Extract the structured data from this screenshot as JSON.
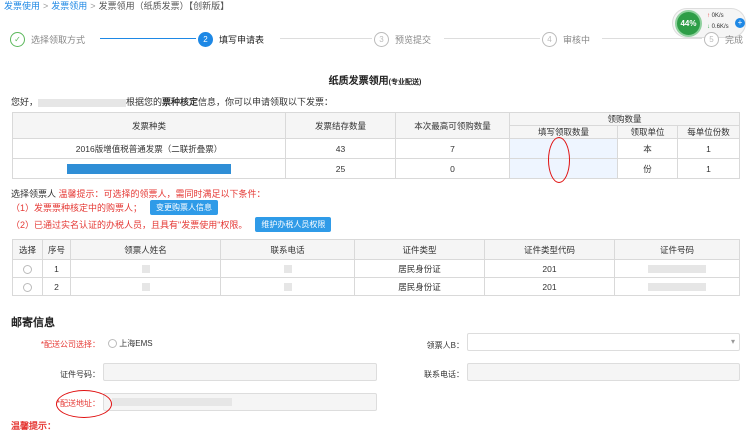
{
  "breadcrumb": {
    "item1": "发票使用",
    "item2": "发票领用",
    "current": "发票领用（纸质发票）【创新版】",
    "separator": ">"
  },
  "steps": [
    {
      "num": "✓",
      "label": "选择领取方式",
      "state": "done"
    },
    {
      "num": "2",
      "label": "填写申请表",
      "state": "active"
    },
    {
      "num": "3",
      "label": "预览提交",
      "state": "todo"
    },
    {
      "num": "4",
      "label": "审核中",
      "state": "todo"
    },
    {
      "num": "5",
      "label": "完成",
      "state": "todo"
    }
  ],
  "net_widget": {
    "percent": "44%",
    "up_speed": "0K/s",
    "down_speed": "0.6K/s",
    "up_arrow": "↑",
    "down_arrow": "↓",
    "plus": "+"
  },
  "page_title": {
    "main": "纸质发票领用",
    "sub": "(专业配送)"
  },
  "greeting": {
    "prefix": "您好，",
    "mid": "根据您的",
    "bold": "票种核定",
    "suffix": "信息，你可以申请领取以下发票："
  },
  "invoice_table": {
    "headers": {
      "type": "发票种类",
      "stock": "发票结存数量",
      "max": "本次最高可领购数量",
      "group": "领购数量",
      "fill": "填写领取数量",
      "unit": "领取单位",
      "per_unit": "每单位份数"
    },
    "rows": [
      {
        "type": "2016版增值税普通发票（二联折叠票）",
        "stock": "43",
        "max": "7",
        "fill": "",
        "unit": "本",
        "per_unit": "1"
      },
      {
        "type": "",
        "stock": "25",
        "max": "0",
        "fill": "",
        "unit": "份",
        "per_unit": "1"
      }
    ]
  },
  "recipient_tip": {
    "label": "选择领票人 ",
    "tip": "温馨提示：可选择的领票人，需同时满足以下条件："
  },
  "conditions": [
    {
      "text": "（1）发票票种核定中的购票人；",
      "button": "变更购票人信息"
    },
    {
      "text": "（2）已通过实名认证的办税人员，且具有\"发票使用\"权限。",
      "button": "维护办税人员权限"
    }
  ],
  "person_table": {
    "headers": [
      "选择",
      "序号",
      "领票人姓名",
      "联系电话",
      "证件类型",
      "证件类型代码",
      "证件号码"
    ],
    "rows": [
      {
        "seq": "1",
        "id_type": "居民身份证",
        "id_code": "201"
      },
      {
        "seq": "2",
        "id_type": "居民身份证",
        "id_code": "201"
      }
    ]
  },
  "mail": {
    "section_title": "邮寄信息",
    "company_label": "*配送公司选择：",
    "company_option": "上海EMS",
    "receiver_label": "领票人B：",
    "id_label": "证件号码：",
    "phone_label": "联系电话：",
    "address_label": "*配送地址："
  },
  "bottom_tip": "温馨提示：",
  "colors": {
    "accent": "#1e88e5",
    "warning": "#e53935",
    "success": "#5cb85c",
    "input_bg": "#eef5ff"
  }
}
